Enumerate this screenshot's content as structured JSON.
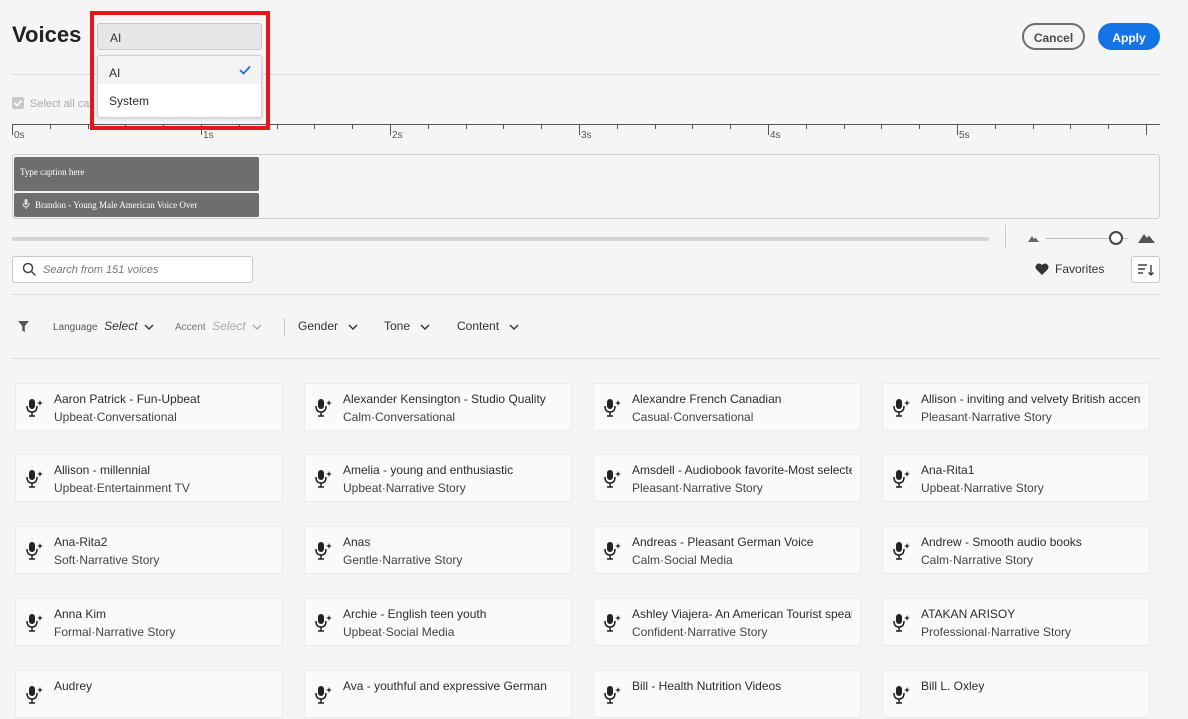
{
  "header": {
    "title": "Voices",
    "dropdown": {
      "value": "AI",
      "options": [
        "AI",
        "System"
      ],
      "selected": "AI"
    },
    "cancel_label": "Cancel",
    "apply_label": "Apply"
  },
  "select_all": {
    "label": "Select all ca"
  },
  "timeline": {
    "labels": [
      "0s",
      "1s",
      "2s",
      "3s",
      "4s",
      "5s"
    ]
  },
  "track": {
    "caption_text": "Type caption here",
    "voice_clip": "Brandon - Young Male American Voice Over"
  },
  "search": {
    "placeholder": "Search from 151 voices"
  },
  "favorites_label": "Favorites",
  "filters": {
    "language_label": "Language",
    "language_value": "Select",
    "accent_label": "Accent",
    "accent_value": "Select",
    "gender_label": "Gender",
    "tone_label": "Tone",
    "content_label": "Content"
  },
  "voices": [
    {
      "name": "Aaron Patrick - Fun-Upbeat",
      "tags": "Upbeat·Conversational"
    },
    {
      "name": "Alexander Kensington - Studio Quality",
      "tags": "Calm·Conversational"
    },
    {
      "name": "Alexandre French Canadian",
      "tags": "Casual·Conversational"
    },
    {
      "name": "Allison - inviting and velvety British accent",
      "tags": "Pleasant·Narrative Story"
    },
    {
      "name": "Allison - millennial",
      "tags": "Upbeat·Entertainment TV"
    },
    {
      "name": "Amelia - young and enthusiastic",
      "tags": "Upbeat·Narrative Story"
    },
    {
      "name": "Amsdell - Audiobook favorite-Most selecte...",
      "tags": "Pleasant·Narrative Story"
    },
    {
      "name": "Ana-Rita1",
      "tags": "Upbeat·Narrative Story"
    },
    {
      "name": "Ana-Rita2",
      "tags": "Soft·Narrative Story"
    },
    {
      "name": "Anas",
      "tags": "Gentle·Narrative Story"
    },
    {
      "name": "Andreas - Pleasant German Voice",
      "tags": "Calm·Social Media"
    },
    {
      "name": "Andrew - Smooth audio books",
      "tags": "Calm·Narrative Story"
    },
    {
      "name": "Anna Kim",
      "tags": "Formal·Narrative Story"
    },
    {
      "name": "Archie - English teen youth",
      "tags": "Upbeat·Social Media"
    },
    {
      "name": "Ashley Viajera- An American Tourist speaki...",
      "tags": "Confident·Narrative Story"
    },
    {
      "name": "ATAKAN ARISOY",
      "tags": "Professional·Narrative Story"
    },
    {
      "name": "Audrey",
      "tags": ""
    },
    {
      "name": "Ava - youthful and expressive German",
      "tags": ""
    },
    {
      "name": "Bill - Health Nutrition Videos",
      "tags": ""
    },
    {
      "name": "Bill L. Oxley",
      "tags": ""
    }
  ],
  "colors": {
    "accent": "#1473e6",
    "highlight": "#e8141b",
    "clip": "#6e6e6e"
  }
}
